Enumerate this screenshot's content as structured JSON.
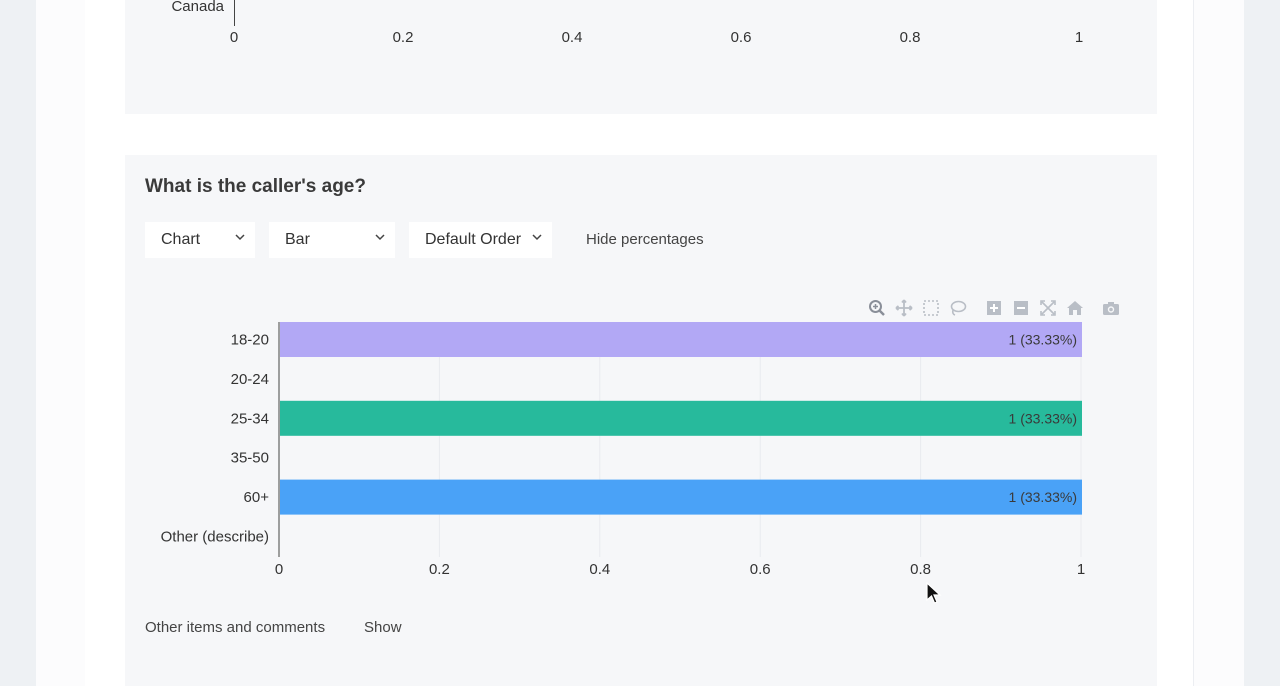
{
  "top_chart": {
    "category_label": "Canada",
    "x_ticks": [
      "0",
      "0.2",
      "0.4",
      "0.6",
      "0.8",
      "1"
    ]
  },
  "question": {
    "title": "What is the caller's age?",
    "controls": {
      "view_select": "Chart",
      "type_select": "Bar",
      "order_select": "Default Order",
      "toggle_percentages": "Hide percentages"
    },
    "footer": {
      "other_items_label": "Other items and comments",
      "show_link": "Show"
    }
  },
  "modebar_icons": [
    "zoom-icon",
    "pan-icon",
    "box-select-icon",
    "lasso-icon",
    "zoom-in-icon",
    "zoom-out-icon",
    "autoscale-icon",
    "reset-axes-icon",
    "camera-icon"
  ],
  "chart_data": {
    "type": "bar",
    "orientation": "horizontal",
    "categories": [
      "18-20",
      "20-24",
      "25-34",
      "35-50",
      "60+",
      "Other (describe)"
    ],
    "values": [
      1,
      0,
      1,
      0,
      1,
      0
    ],
    "data_labels": [
      "1 (33.33%)",
      "",
      "1 (33.33%)",
      "",
      "1 (33.33%)",
      ""
    ],
    "colors": [
      "#b2a8f5",
      "",
      "#27ba9c",
      "",
      "#4aa2f7",
      ""
    ],
    "x_ticks": [
      "0",
      "0.2",
      "0.4",
      "0.6",
      "0.8",
      "1"
    ],
    "xlim": [
      0,
      1
    ],
    "grid": true
  }
}
